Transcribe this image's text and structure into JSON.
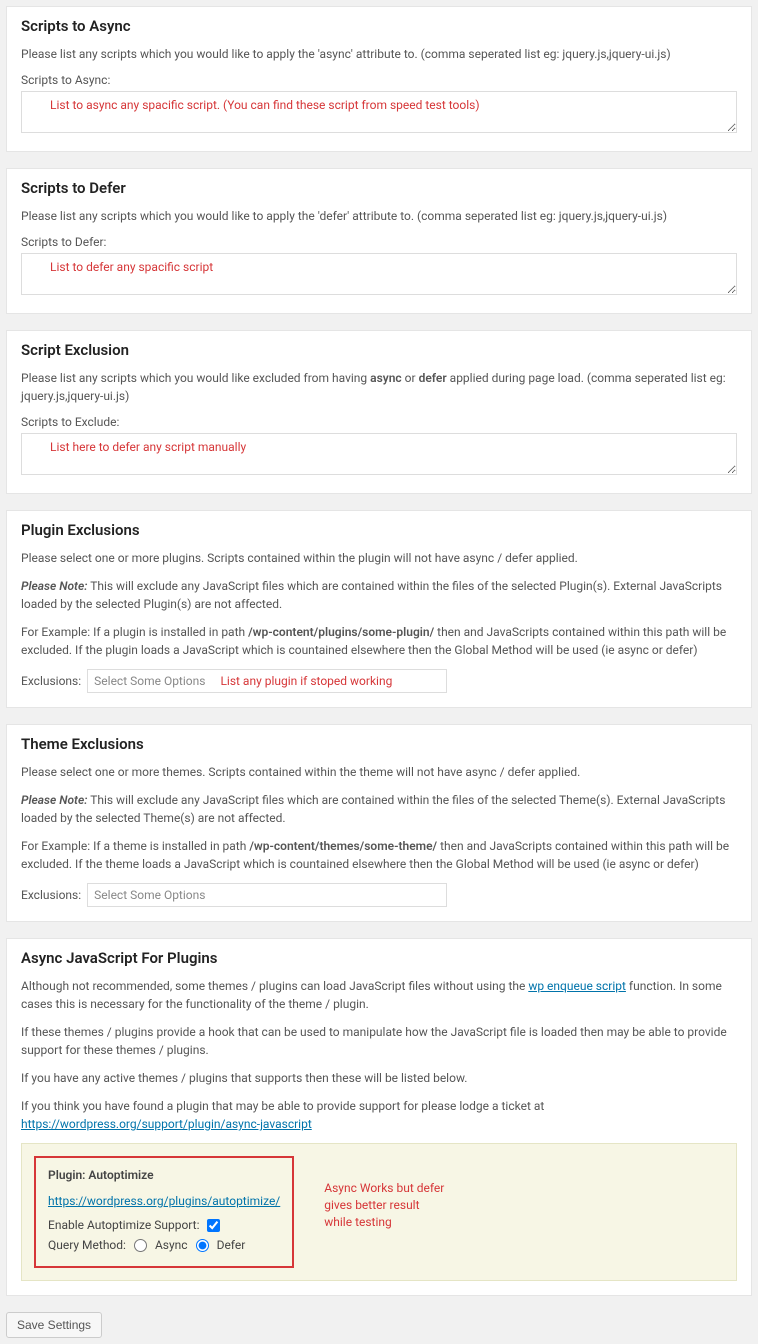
{
  "scriptsAsync": {
    "title": "Scripts to Async",
    "desc": "Please list any scripts which you would like to apply the 'async' attribute to. (comma seperated list eg: jquery.js,jquery-ui.js)",
    "label": "Scripts to Async:",
    "value": "List to async any spacific script. (You can find these script from speed test tools)"
  },
  "scriptsDefer": {
    "title": "Scripts to Defer",
    "desc": "Please list any scripts which you would like to apply the 'defer' attribute to. (comma seperated list eg: jquery.js,jquery-ui.js)",
    "label": "Scripts to Defer:",
    "value": "List to defer any spacific script"
  },
  "scriptExclusion": {
    "title": "Script Exclusion",
    "desc_pre": "Please list any scripts which you would like excluded from having ",
    "desc_bold1": "async",
    "desc_mid": " or ",
    "desc_bold2": "defer",
    "desc_post": " applied during page load. (comma seperated list eg: jquery.js,jquery-ui.js)",
    "label": "Scripts to Exclude:",
    "value": "List here to defer any script manually"
  },
  "pluginExclusions": {
    "title": "Plugin Exclusions",
    "desc1": "Please select one or more plugins. Scripts contained within the plugin will not have async / defer applied.",
    "note_label": "Please Note:",
    "note_text": " This will exclude any JavaScript files which are contained within the files of the selected Plugin(s). External JavaScripts loaded by the selected Plugin(s) are not affected.",
    "example_pre": "For Example: If a plugin is installed in path ",
    "example_bold": "/wp-content/plugins/some-plugin/",
    "example_post": " then and JavaScripts contained within this path will be excluded. If the plugin loads a JavaScript which is countained elsewhere then the Global Method will be used (ie async or defer)",
    "exclusions_label": "Exclusions:",
    "placeholder": "Select Some Options",
    "red_note": "List any plugin if stoped working"
  },
  "themeExclusions": {
    "title": "Theme Exclusions",
    "desc1": "Please select one or more themes. Scripts contained within the theme will not have async / defer applied.",
    "note_label": "Please Note:",
    "note_text": " This will exclude any JavaScript files which are contained within the files of the selected Theme(s). External JavaScripts loaded by the selected Theme(s) are not affected.",
    "example_pre": "For Example: If a theme is installed in path ",
    "example_bold": "/wp-content/themes/some-theme/",
    "example_post": " then and JavaScripts contained within this path will be excluded. If the theme loads a JavaScript which is countained elsewhere then the Global Method will be used (ie async or defer)",
    "exclusions_label": "Exclusions:",
    "placeholder": "Select Some Options"
  },
  "asyncJsPlugins": {
    "title": "Async JavaScript For Plugins",
    "p1_pre": "Although not recommended, some themes / plugins can load JavaScript files without using the ",
    "p1_link": "wp enqueue script",
    "p1_post": " function. In some cases this is necessary for the functionality of the theme / plugin.",
    "p2": "If these themes / plugins provide a hook that can be used to manipulate how the JavaScript file is loaded then may be able to provide support for these themes / plugins.",
    "p3": "If you have any active themes / plugins that supports then these will be listed below.",
    "p4_pre": "If you think you have found a plugin that may be able to provide support for please lodge a ticket at ",
    "p4_link": "https://wordpress.org/support/plugin/async-javascript",
    "plugin_title": "Plugin: Autoptimize",
    "plugin_url": "https://wordpress.org/plugins/autoptimize/",
    "enable_label": "Enable Autoptimize Support:",
    "query_label": "Query Method:",
    "opt_async": "Async",
    "opt_defer": "Defer",
    "red_note1": "Async Works but defer",
    "red_note2": "gives better result",
    "red_note3": "while testing"
  },
  "save": "Save Settings"
}
